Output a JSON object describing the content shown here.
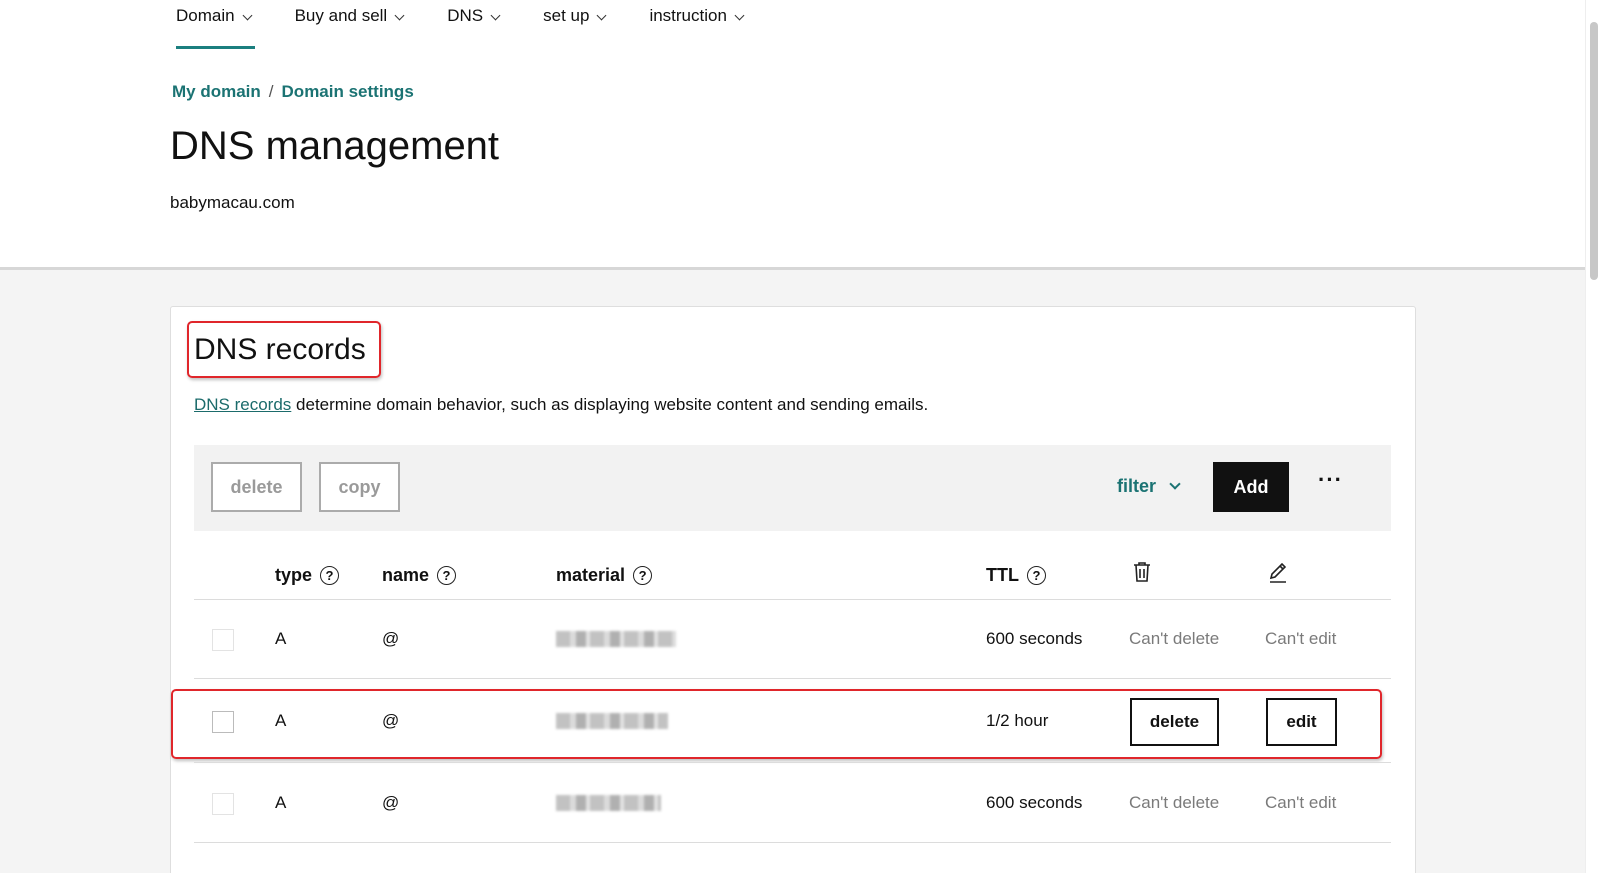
{
  "nav": {
    "items": [
      {
        "label": "Domain"
      },
      {
        "label": "Buy and sell"
      },
      {
        "label": "DNS"
      },
      {
        "label": "set up"
      },
      {
        "label": "instruction"
      }
    ]
  },
  "breadcrumb": {
    "item1": "My domain",
    "separator": "/",
    "item2": "Domain settings"
  },
  "page": {
    "title": "DNS management",
    "domain": "babymacau.com"
  },
  "card": {
    "title": "DNS records",
    "desc_link": "DNS records",
    "desc_text": " determine domain behavior, such as displaying website content and sending emails."
  },
  "toolbar": {
    "delete_label": "delete",
    "copy_label": "copy",
    "filter_label": "filter",
    "add_label": "Add",
    "more_label": "···"
  },
  "table": {
    "headers": {
      "type": "type",
      "name": "name",
      "material": "material",
      "ttl": "TTL"
    },
    "help_glyph": "?",
    "rows": [
      {
        "type": "A",
        "name": "@",
        "ttl": "600 seconds",
        "delete": "Can't delete",
        "edit": "Can't edit"
      },
      {
        "type": "A",
        "name": "@",
        "ttl": "1/2 hour",
        "delete": "delete",
        "edit": "edit"
      },
      {
        "type": "A",
        "name": "@",
        "ttl": "600 seconds",
        "delete": "Can't delete",
        "edit": "Can't edit"
      }
    ]
  },
  "colors": {
    "accent": "#1b7373",
    "highlight": "#e0262b",
    "primary_button": "#111111"
  },
  "icons": {
    "trash": "trash-icon",
    "edit": "pencil-icon",
    "help": "question-circle-icon"
  }
}
